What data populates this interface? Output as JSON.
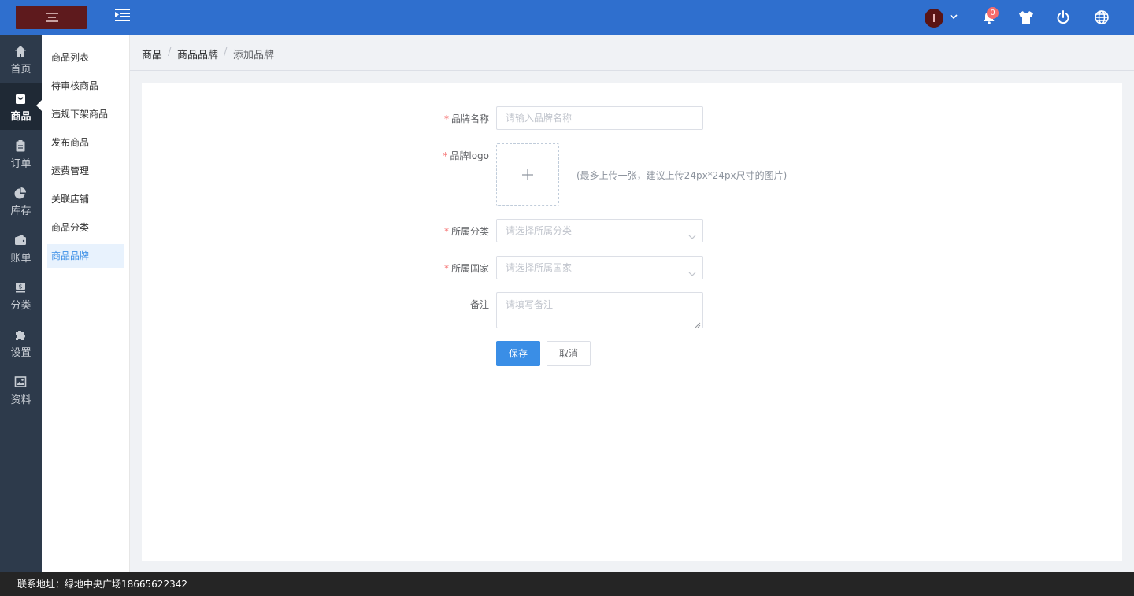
{
  "header": {
    "notification_count": "0"
  },
  "main_nav": [
    {
      "label": "首页",
      "icon": "home-icon"
    },
    {
      "label": "商品",
      "icon": "shopping-bag-icon",
      "active": true
    },
    {
      "label": "订单",
      "icon": "clipboard-icon"
    },
    {
      "label": "库存",
      "icon": "pie-chart-icon"
    },
    {
      "label": "账单",
      "icon": "wallet-icon"
    },
    {
      "label": "分类",
      "icon": "money-icon"
    },
    {
      "label": "设置",
      "icon": "puzzle-icon"
    },
    {
      "label": "资料",
      "icon": "image-icon"
    }
  ],
  "sub_nav": [
    {
      "label": "商品列表"
    },
    {
      "label": "待审核商品"
    },
    {
      "label": "违规下架商品"
    },
    {
      "label": "发布商品"
    },
    {
      "label": "运费管理"
    },
    {
      "label": "关联店铺"
    },
    {
      "label": "商品分类"
    },
    {
      "label": "商品品牌",
      "active": true
    }
  ],
  "breadcrumb": [
    "商品",
    "商品品牌",
    "添加品牌"
  ],
  "form": {
    "brand_name": {
      "label": "品牌名称",
      "required": "*",
      "placeholder": "请输入品牌名称"
    },
    "brand_logo": {
      "label": "品牌logo",
      "required": "*",
      "hint": "(最多上传一张，建议上传24px*24px尺寸的图片)"
    },
    "category": {
      "label": "所属分类",
      "required": "*",
      "placeholder": "请选择所属分类"
    },
    "country": {
      "label": "所属国家",
      "required": "*",
      "placeholder": "请选择所属国家"
    },
    "remark": {
      "label": "备注",
      "placeholder": "请填写备注"
    },
    "save_label": "保存",
    "cancel_label": "取消"
  },
  "footer": {
    "text": "联系地址：绿地中央广场18665622342"
  },
  "colors": {
    "header": "#2f6fce",
    "nav": "#2d3a4b",
    "primary": "#3a8ee6",
    "required": "#f56c6c"
  }
}
